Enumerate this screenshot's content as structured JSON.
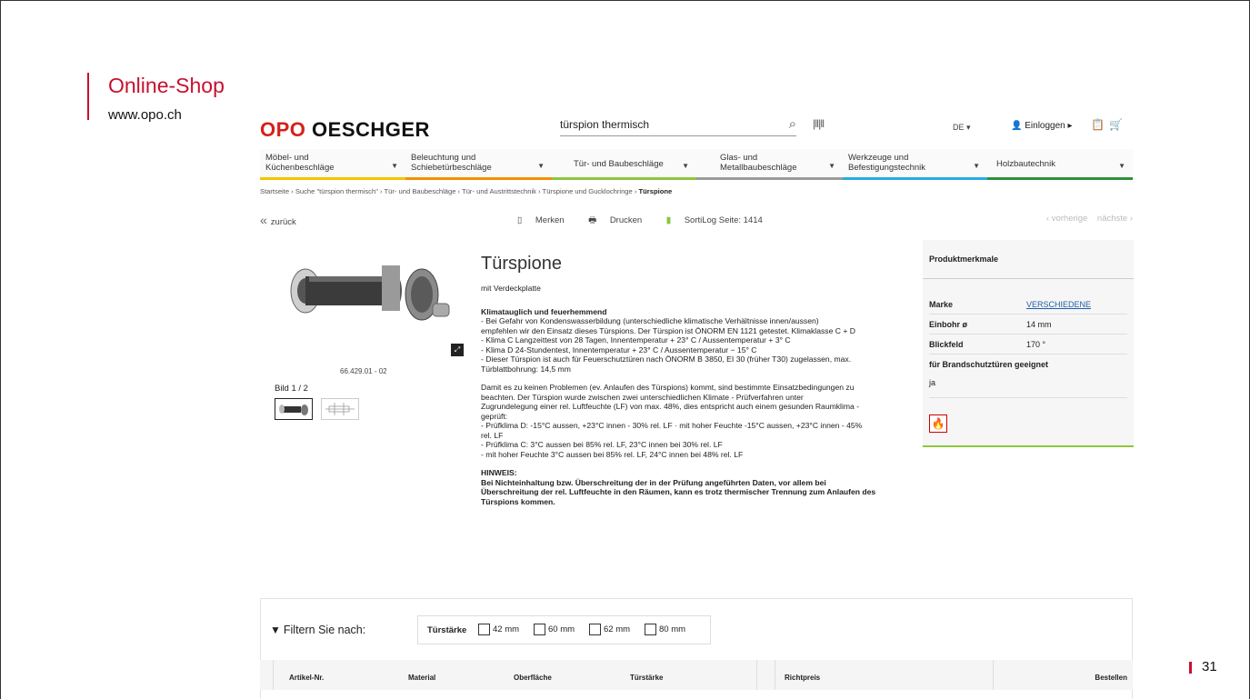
{
  "slide": {
    "title": "Online-Shop",
    "url": "www.opo.ch",
    "page_number": "31"
  },
  "header": {
    "logo_part1": "OPO",
    "logo_part2": "OESCHGER",
    "search_value": "türspion thermisch",
    "lang": "DE ▾",
    "login": "Einloggen ▸"
  },
  "categories": [
    {
      "line1": "Möbel- und",
      "line2": "Küchenbeschläge",
      "color": "#f2c500"
    },
    {
      "line1": "Beleuchtung und",
      "line2": "Schiebetürbeschläge",
      "color": "#f29100"
    },
    {
      "line1": "Tür- und Baubeschläge",
      "line2": "",
      "color": "#8dc63f"
    },
    {
      "line1": "Glas- und",
      "line2": "Metallbaubeschläge",
      "color": "#9b9b9b"
    },
    {
      "line1": "Werkzeuge und",
      "line2": "Befestigungstechnik",
      "color": "#29abe2"
    },
    {
      "line1": "Holzbautechnik",
      "line2": "",
      "color": "#2f8f3a"
    }
  ],
  "breadcrumb": {
    "path": "Startseite › Suche \"türspion thermisch\" › Tür- und Baubeschläge › Tür- und Austrittstechnik › Türspione und Gucklochringe › ",
    "current": "Türspione"
  },
  "toolbar": {
    "back": "zurück",
    "merken": "Merken",
    "drucken": "Drucken",
    "sortilog": "SortiLog Seite: 1414",
    "prev": "vorherige",
    "next": "nächste"
  },
  "gallery": {
    "article": "66.429.01 - 02",
    "image_counter": "Bild 1 / 2"
  },
  "product": {
    "title": "Türspione",
    "subtitle": "mit Verdeckplatte",
    "heading1": "Klimatauglich und feuerhemmend",
    "para1": [
      "- Bei Gefahr von Kondenswasserbildung (unterschiedliche klimatische Verhältnisse innen/aussen)",
      "empfehlen wir den Einsatz dieses Türspions. Der Türspion ist ÖNORM EN 1121 getestet. Klimaklasse C + D",
      "- Klima C Langzeittest von 28 Tagen, Innentemperatur + 23° C / Aussentemperatur + 3° C",
      "- Klima D 24-Stundentest, Innentemperatur + 23° C / Aussentemperatur − 15° C",
      "- Dieser Türspion ist auch für Feuerschutztüren nach ÖNORM B 3850, EI 30 (früher T30) zugelassen, max.",
      "Türblattbohrung: 14,5 mm"
    ],
    "para2": [
      "Damit es zu keinen Problemen (ev. Anlaufen des Türspions) kommt, sind bestimmte Einsatzbedingungen zu",
      "beachten. Der Türspion wurde zwischen zwei unterschiedlichen Klimate - Prüfverfahren unter",
      "Zugrundelegung einer rel. Luftfeuchte (LF) von max. 48%, dies entspricht auch einem gesunden Raumklima -",
      "geprüft:",
      "- Prüfklima D: -15°C aussen, +23°C innen - 30% rel. LF · mit hoher Feuchte -15°C aussen, +23°C innen - 45%",
      "rel. LF",
      "- Prüfklima C: 3°C aussen bei 85% rel. LF, 23°C innen bei 30% rel. LF",
      "- mit hoher Feuchte 3°C aussen bei 85% rel. LF, 24°C innen bei 48% rel. LF"
    ],
    "hinweis_title": "HINWEIS:",
    "hinweis": [
      "Bei Nichteinhaltung bzw. Überschreitung der in der Prüfung angeführten Daten, vor allem bei",
      "Überschreitung der rel. Luftfeuchte in den Räumen, kann es trotz thermischer Trennung zum Anlaufen des",
      "Türspions kommen."
    ]
  },
  "features": {
    "title": "Produktmerkmale",
    "marke_label": "Marke",
    "marke_value": "VERSCHIEDENE",
    "einbohr_label": "Einbohr ø",
    "einbohr_value": "14 mm",
    "blickfeld_label": "Blickfeld",
    "blickfeld_value": "170 °",
    "brand_label": "für Brandschutztüren geeignet",
    "brand_value": "ja"
  },
  "filter": {
    "label": "Filtern Sie nach:",
    "group_label": "Türstärke",
    "options": [
      "42 mm",
      "60 mm",
      "62 mm",
      "80 mm"
    ]
  },
  "table": {
    "columns": [
      "Artikel-Nr.",
      "Material",
      "Oberfläche",
      "Türstärke",
      "Richtpreis",
      "Bestellen"
    ]
  }
}
